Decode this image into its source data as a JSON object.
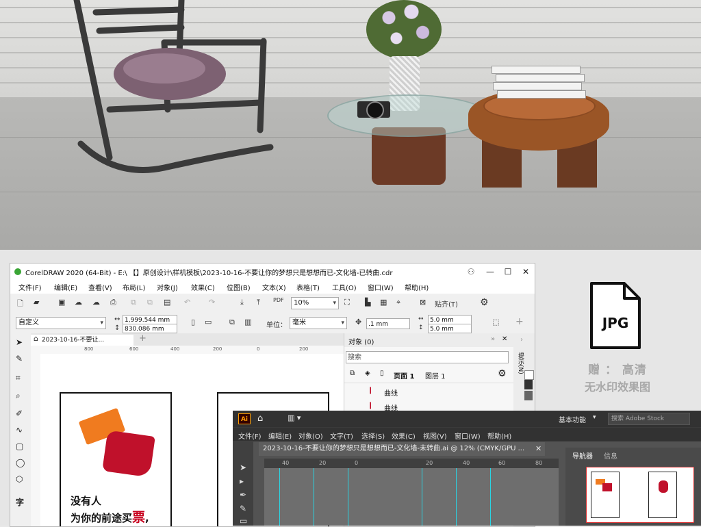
{
  "corel": {
    "title": "CorelDRAW 2020 (64-Bit) - E:\\ 【】原创设计\\样机模板\\2023-10-16-不要让你的梦想只是想想而已-文化墙-已转曲.cdr",
    "menu": [
      "文件(F)",
      "编辑(E)",
      "查看(V)",
      "布局(L)",
      "对象(J)",
      "效果(C)",
      "位图(B)",
      "文本(X)",
      "表格(T)",
      "工具(O)",
      "窗口(W)",
      "帮助(H)"
    ],
    "zoom": "10%",
    "snap_label": "贴齐(T)",
    "preset": "自定义",
    "width_value": "1,999.544 mm",
    "height_value": "830.086 mm",
    "units_label": "单位：",
    "units_value": "毫米",
    "nudge": ".1 mm",
    "dup_x": "5.0 mm",
    "dup_y": "5.0 mm",
    "doc_tab": "2023-10-16-不要让...",
    "ruler": [
      "800",
      "600",
      "400",
      "200",
      "0",
      "200"
    ],
    "objects_title": "对象 (0)",
    "search_placeholder": "搜索",
    "page_label": "页面 1",
    "layer_label": "图层 1",
    "object_rows": [
      "曲线",
      "曲线"
    ],
    "side_tab": "提示(N)",
    "poster_line1": "没有人",
    "poster_line2_a": "为你的前途买",
    "poster_line2_b": "票",
    "poster_line2_c": ","
  },
  "illustrator": {
    "workspace": "基本功能",
    "search_placeholder": "搜索 Adobe Stock",
    "menu": [
      "文件(F)",
      "编辑(E)",
      "对象(O)",
      "文字(T)",
      "选择(S)",
      "效果(C)",
      "视图(V)",
      "窗口(W)",
      "帮助(H)"
    ],
    "doc_tab": "2023-10-16-不要让你的梦想只是想想而已-文化墙-未转曲.ai @ 12% (CMYK/GPU ...",
    "ruler": [
      "40",
      "20",
      "0",
      "20",
      "40",
      "60",
      "80"
    ],
    "panel_tabs": [
      "导航器",
      "信息"
    ],
    "logo": "Ai"
  },
  "badge": {
    "format": "JPG",
    "line1": "赠 ： 高清",
    "line2": "无水印效果图"
  }
}
